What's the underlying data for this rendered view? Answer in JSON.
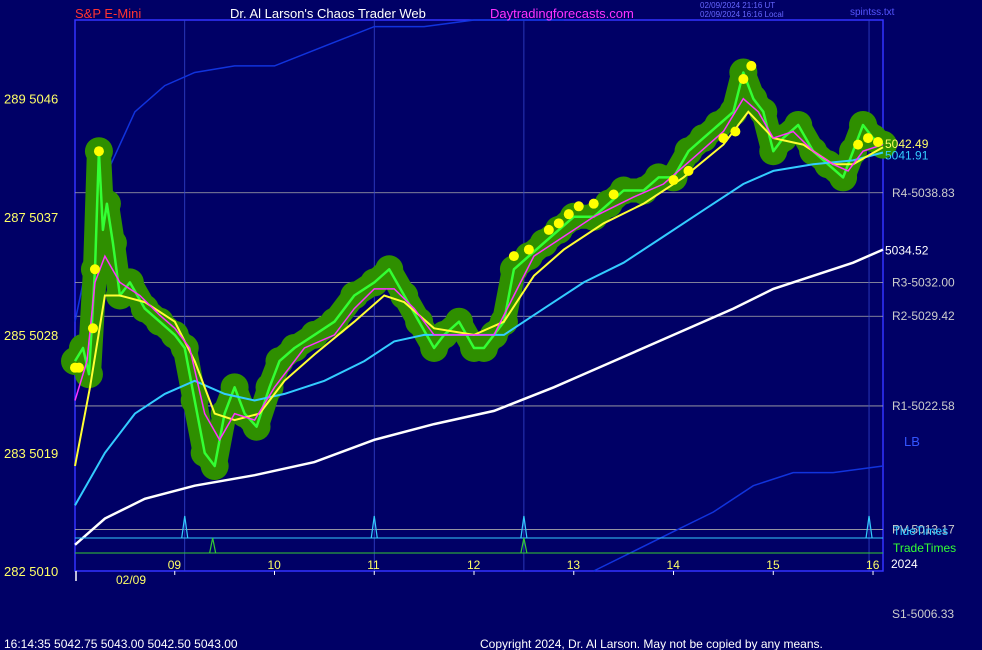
{
  "header": {
    "symbol": "S&P E-Mini",
    "title": "Dr. Al Larson's Chaos Trader Web",
    "site": "Daytradingforecasts.com",
    "utc_stamp": "02/09/2024 21:16 UT",
    "local_stamp": "02/09/2024 16:16 Local",
    "file": "spintss.txt"
  },
  "footer": {
    "quote": "16:14:35  5042.75 5043.00 5042.50 5043.00",
    "copyright": "Copyright 2024, Dr. Al Larson. May not be copied by any means."
  },
  "colors": {
    "background": "#000066",
    "frame": "#3333ff",
    "price": "#33ff33",
    "glow": "#2f8f00",
    "ema_fast": "#ff33ff",
    "ema_mid": "#ffff33",
    "ema_slow": "#33ccff",
    "ema_long": "#ffffff",
    "envelope": "#1133dd",
    "levels": "#aaaaaa",
    "dots": "#ffff00"
  },
  "chart_data": {
    "type": "line",
    "xlim": [
      8.0,
      16.1
    ],
    "ylim": [
      5010,
      5052
    ],
    "y_ticks": [
      {
        "value": 5046,
        "label": "289  5046"
      },
      {
        "value": 5037,
        "label": "287  5037"
      },
      {
        "value": 5028,
        "label": "285  5028"
      },
      {
        "value": 5019,
        "label": "283  5019"
      },
      {
        "value": 5010,
        "label": "282  5010"
      }
    ],
    "x_ticks": [
      {
        "value": 9,
        "label": "09"
      },
      {
        "value": 10,
        "label": "10"
      },
      {
        "value": 11,
        "label": "11"
      },
      {
        "value": 12,
        "label": "12"
      },
      {
        "value": 13,
        "label": "13"
      },
      {
        "value": 14,
        "label": "14"
      },
      {
        "value": 15,
        "label": "15"
      },
      {
        "value": 16,
        "label": "16"
      }
    ],
    "date_label": "02/09",
    "year_label": "2024",
    "levels": [
      {
        "label": "R4-5038.83",
        "value": 5038.83
      },
      {
        "label": "R3-5032.00",
        "value": 5032.0
      },
      {
        "label": "R2-5029.42",
        "value": 5029.42
      },
      {
        "label": "R1-5022.58",
        "value": 5022.58
      },
      {
        "label": "PV-5013.17",
        "value": 5013.17
      },
      {
        "label": "S1-5006.33",
        "value": 5006.33
      }
    ],
    "last_price_labels": [
      {
        "label": "5042.49",
        "value": 5042.49
      },
      {
        "label": "5041.91",
        "value": 5041.91
      },
      {
        "label": "5034.52",
        "value": 5034.52
      }
    ],
    "band_label": "LB",
    "tide_label": "TideTimes",
    "trade_label": "TradeTimes",
    "tide_times": [
      9.1,
      11.0,
      12.5,
      15.96
    ],
    "trade_times": [
      9.38,
      12.5
    ],
    "session_lines": [
      9.1,
      11.0,
      12.5,
      15.96
    ],
    "price": [
      [
        8.0,
        5026
      ],
      [
        8.08,
        5027
      ],
      [
        8.14,
        5025
      ],
      [
        8.2,
        5033
      ],
      [
        8.24,
        5042
      ],
      [
        8.28,
        5036
      ],
      [
        8.32,
        5038
      ],
      [
        8.38,
        5035
      ],
      [
        8.45,
        5031
      ],
      [
        8.55,
        5032
      ],
      [
        8.7,
        5030
      ],
      [
        8.85,
        5029
      ],
      [
        9.0,
        5028
      ],
      [
        9.1,
        5027
      ],
      [
        9.2,
        5023
      ],
      [
        9.3,
        5019
      ],
      [
        9.4,
        5018
      ],
      [
        9.5,
        5022
      ],
      [
        9.6,
        5024
      ],
      [
        9.7,
        5022
      ],
      [
        9.82,
        5021
      ],
      [
        9.95,
        5024
      ],
      [
        10.05,
        5026
      ],
      [
        10.2,
        5027
      ],
      [
        10.4,
        5028
      ],
      [
        10.6,
        5029
      ],
      [
        10.8,
        5031
      ],
      [
        11.0,
        5032
      ],
      [
        11.15,
        5033
      ],
      [
        11.3,
        5031
      ],
      [
        11.45,
        5029
      ],
      [
        11.6,
        5027
      ],
      [
        11.7,
        5028
      ],
      [
        11.85,
        5029
      ],
      [
        12.0,
        5027
      ],
      [
        12.1,
        5027
      ],
      [
        12.2,
        5028
      ],
      [
        12.3,
        5029
      ],
      [
        12.4,
        5033
      ],
      [
        12.55,
        5034
      ],
      [
        12.7,
        5035
      ],
      [
        12.85,
        5036
      ],
      [
        13.0,
        5037
      ],
      [
        13.2,
        5037
      ],
      [
        13.35,
        5038
      ],
      [
        13.5,
        5039
      ],
      [
        13.7,
        5039
      ],
      [
        13.85,
        5040
      ],
      [
        14.0,
        5040
      ],
      [
        14.15,
        5042
      ],
      [
        14.3,
        5043
      ],
      [
        14.45,
        5044
      ],
      [
        14.6,
        5045
      ],
      [
        14.7,
        5048
      ],
      [
        14.8,
        5046
      ],
      [
        14.9,
        5045
      ],
      [
        15.0,
        5042
      ],
      [
        15.1,
        5043
      ],
      [
        15.25,
        5044
      ],
      [
        15.4,
        5042
      ],
      [
        15.55,
        5041
      ],
      [
        15.7,
        5040
      ],
      [
        15.8,
        5042
      ],
      [
        15.9,
        5044
      ],
      [
        16.0,
        5043
      ],
      [
        16.1,
        5042.5
      ]
    ],
    "ema_fast": [
      [
        8.0,
        5023
      ],
      [
        8.12,
        5026
      ],
      [
        8.2,
        5032
      ],
      [
        8.3,
        5034
      ],
      [
        8.45,
        5032
      ],
      [
        8.65,
        5031
      ],
      [
        8.85,
        5029.5
      ],
      [
        9.0,
        5028.5
      ],
      [
        9.15,
        5027
      ],
      [
        9.3,
        5022
      ],
      [
        9.45,
        5020
      ],
      [
        9.6,
        5022
      ],
      [
        9.8,
        5021.5
      ],
      [
        10.0,
        5024
      ],
      [
        10.3,
        5027
      ],
      [
        10.6,
        5028
      ],
      [
        10.8,
        5030
      ],
      [
        11.0,
        5031.5
      ],
      [
        11.2,
        5031.5
      ],
      [
        11.4,
        5030
      ],
      [
        11.6,
        5028
      ],
      [
        11.9,
        5028
      ],
      [
        12.2,
        5028
      ],
      [
        12.4,
        5031
      ],
      [
        12.6,
        5034
      ],
      [
        12.9,
        5035.5
      ],
      [
        13.2,
        5037
      ],
      [
        13.6,
        5038.5
      ],
      [
        13.9,
        5039.5
      ],
      [
        14.2,
        5041.5
      ],
      [
        14.5,
        5043.5
      ],
      [
        14.7,
        5046
      ],
      [
        14.85,
        5045
      ],
      [
        15.0,
        5043
      ],
      [
        15.2,
        5043.5
      ],
      [
        15.4,
        5042
      ],
      [
        15.6,
        5041
      ],
      [
        15.75,
        5040.5
      ],
      [
        15.9,
        5042
      ],
      [
        16.1,
        5042.5
      ]
    ],
    "ema_mid": [
      [
        8.0,
        5018
      ],
      [
        8.15,
        5024
      ],
      [
        8.3,
        5031
      ],
      [
        8.45,
        5031
      ],
      [
        8.7,
        5030.5
      ],
      [
        9.0,
        5029
      ],
      [
        9.2,
        5026
      ],
      [
        9.4,
        5022
      ],
      [
        9.6,
        5021.5
      ],
      [
        9.85,
        5022
      ],
      [
        10.1,
        5024.5
      ],
      [
        10.4,
        5026.5
      ],
      [
        10.8,
        5029
      ],
      [
        11.1,
        5031
      ],
      [
        11.3,
        5030.5
      ],
      [
        11.6,
        5028.5
      ],
      [
        12.0,
        5028
      ],
      [
        12.3,
        5029
      ],
      [
        12.6,
        5032.5
      ],
      [
        12.9,
        5034.5
      ],
      [
        13.3,
        5036.5
      ],
      [
        13.7,
        5038
      ],
      [
        14.1,
        5040
      ],
      [
        14.5,
        5042.5
      ],
      [
        14.75,
        5045
      ],
      [
        15.0,
        5043
      ],
      [
        15.3,
        5042.5
      ],
      [
        15.6,
        5041
      ],
      [
        15.8,
        5041
      ],
      [
        16.1,
        5042.3
      ]
    ],
    "ema_slow": [
      [
        8.0,
        5015
      ],
      [
        8.3,
        5019
      ],
      [
        8.6,
        5022
      ],
      [
        8.9,
        5023.5
      ],
      [
        9.2,
        5024.5
      ],
      [
        9.5,
        5023.5
      ],
      [
        9.8,
        5023
      ],
      [
        10.1,
        5023.5
      ],
      [
        10.5,
        5024.5
      ],
      [
        10.9,
        5026
      ],
      [
        11.2,
        5027.5
      ],
      [
        11.5,
        5028
      ],
      [
        11.9,
        5028
      ],
      [
        12.3,
        5028
      ],
      [
        12.7,
        5030
      ],
      [
        13.1,
        5032
      ],
      [
        13.5,
        5033.5
      ],
      [
        13.9,
        5035.5
      ],
      [
        14.3,
        5037.5
      ],
      [
        14.7,
        5039.5
      ],
      [
        15.0,
        5040.5
      ],
      [
        15.4,
        5041
      ],
      [
        15.8,
        5041.3
      ],
      [
        16.1,
        5041.9
      ]
    ],
    "ema_long": [
      [
        8.0,
        5012
      ],
      [
        8.3,
        5014
      ],
      [
        8.7,
        5015.5
      ],
      [
        9.2,
        5016.5
      ],
      [
        9.8,
        5017.3
      ],
      [
        10.4,
        5018.3
      ],
      [
        11.0,
        5020
      ],
      [
        11.6,
        5021.2
      ],
      [
        12.2,
        5022.2
      ],
      [
        12.8,
        5024
      ],
      [
        13.4,
        5026
      ],
      [
        14.0,
        5028
      ],
      [
        14.6,
        5030
      ],
      [
        15.0,
        5031.5
      ],
      [
        15.4,
        5032.5
      ],
      [
        15.8,
        5033.5
      ],
      [
        16.1,
        5034.5
      ]
    ],
    "envelope_upper": [
      [
        8.0,
        5029
      ],
      [
        8.3,
        5040
      ],
      [
        8.6,
        5045
      ],
      [
        8.9,
        5047
      ],
      [
        9.2,
        5048
      ],
      [
        9.6,
        5048.5
      ],
      [
        10.0,
        5048.5
      ],
      [
        10.5,
        5050
      ],
      [
        11.0,
        5051.5
      ],
      [
        11.5,
        5051.5
      ],
      [
        12.0,
        5052
      ],
      [
        12.5,
        5052
      ],
      [
        12.9,
        5052
      ]
    ],
    "envelope_lower": [
      [
        13.2,
        5010
      ],
      [
        13.6,
        5011.5
      ],
      [
        14.0,
        5013
      ],
      [
        14.4,
        5014.5
      ],
      [
        14.8,
        5016.5
      ],
      [
        15.2,
        5017.5
      ],
      [
        15.6,
        5017.5
      ],
      [
        16.1,
        5018
      ]
    ],
    "markers": [
      [
        8.0,
        5025.5
      ],
      [
        8.04,
        5025.5
      ],
      [
        8.18,
        5028.5
      ],
      [
        8.2,
        5033
      ],
      [
        8.24,
        5042
      ],
      [
        13.4,
        5038.7
      ],
      [
        14.0,
        5039.8
      ],
      [
        14.15,
        5040.5
      ],
      [
        14.5,
        5043
      ],
      [
        14.62,
        5043.5
      ],
      [
        14.7,
        5047.5
      ],
      [
        14.78,
        5048.5
      ],
      [
        12.4,
        5034
      ],
      [
        12.55,
        5034.5
      ],
      [
        12.75,
        5036
      ],
      [
        12.85,
        5036.5
      ],
      [
        12.95,
        5037.2
      ],
      [
        13.05,
        5037.8
      ],
      [
        13.2,
        5038
      ],
      [
        15.85,
        5042.5
      ],
      [
        15.95,
        5043
      ],
      [
        16.05,
        5042.7
      ]
    ]
  }
}
